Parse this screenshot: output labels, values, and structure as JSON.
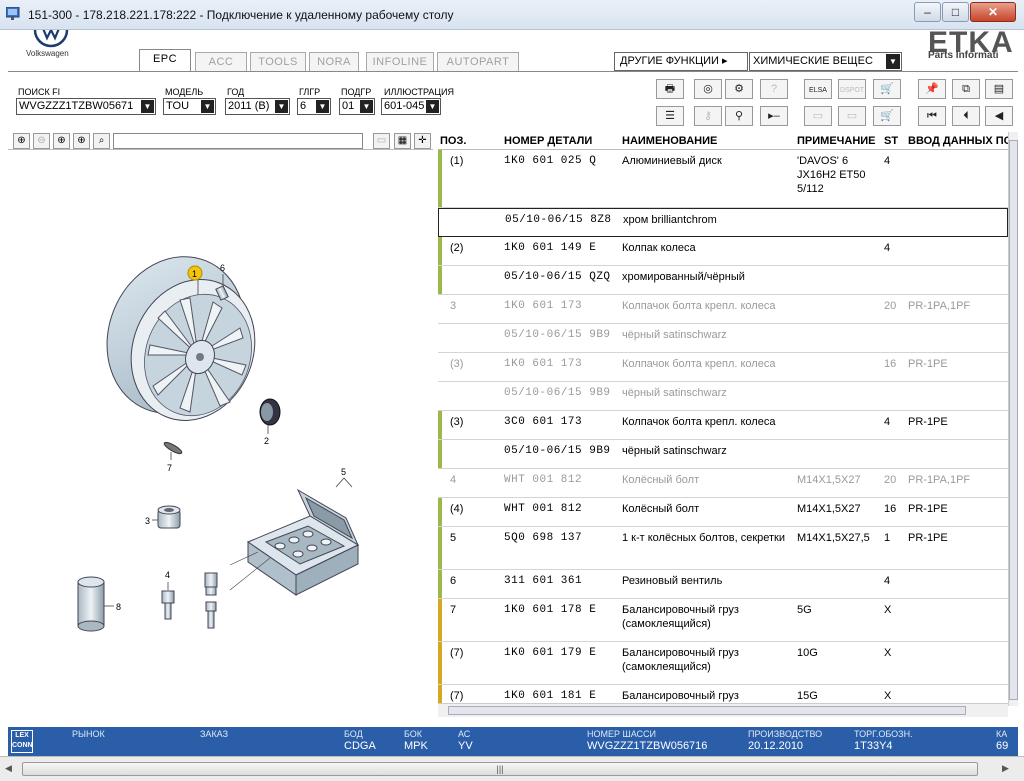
{
  "window": {
    "title": "151-300 - 178.218.221.178:222 - Подключение к удаленному рабочему столу",
    "min": "–",
    "max": "□",
    "close": "✕"
  },
  "brand": {
    "vw": "Volkswagen",
    "etka": "ETKA",
    "etka_sub": "Parts Informati"
  },
  "tabs": [
    "EPC",
    "ACC",
    "TOOLS",
    "NORA",
    "INFOLINE",
    "AUTOPART"
  ],
  "other_functions": "ДРУГИЕ ФУНКЦИИ ▸",
  "chem_select": "ХИМИЧЕСКИЕ ВЕЩЕС",
  "filters": {
    "search_label": "ПОИСК FI",
    "search_value": "WVGZZZ1TZBW05671",
    "model_label": "МОДЕЛЬ",
    "model_value": "TOU",
    "year_label": "ГОД",
    "year_value": "2011 (B)",
    "glgr_label": "ГЛГР",
    "glgr_value": "6",
    "podgr_label": "ПОДГР",
    "podgr_value": "01",
    "ill_label": "ИЛЛЮСТРАЦИЯ",
    "ill_value": "601-045"
  },
  "columns": {
    "pos": "ПОЗ.",
    "pn": "НОМЕР ДЕТАЛИ",
    "name": "НАИМЕНОВАНИЕ",
    "note": "ПРИМЕЧАНИЕ",
    "st": "ST",
    "inp": "ВВОД ДАННЫХ ПО"
  },
  "rows": [
    {
      "pos": "(1)",
      "pn": "1K0 601 025 Q",
      "name": "Алюминиевый диск",
      "note": "'DAVOS' 6 JX16H2 ET50 5/112",
      "st": "4",
      "inp": ""
    },
    {
      "pos": "",
      "pn": "05/10-06/15 8Z8",
      "name": "хром brilliantchrom",
      "note": "",
      "st": "",
      "inp": ""
    },
    {
      "pos": "(2)",
      "pn": "1K0 601 149 E",
      "name": "Колпак колеса",
      "note": "",
      "st": "4",
      "inp": ""
    },
    {
      "pos": "",
      "pn": "05/10-06/15 QZQ",
      "name": "хромированный/чёрный",
      "note": "",
      "st": "",
      "inp": ""
    },
    {
      "pos": "3",
      "pn": "1K0 601 173",
      "name": "Колпачок болта крепл. колеса",
      "note": "",
      "st": "20",
      "inp": "PR-1PA,1PF"
    },
    {
      "pos": "",
      "pn": "05/10-06/15 9B9",
      "name": "чёрный satinschwarz",
      "note": "",
      "st": "",
      "inp": ""
    },
    {
      "pos": "(3)",
      "pn": "1K0 601 173",
      "name": "Колпачок болта крепл. колеса",
      "note": "",
      "st": "16",
      "inp": "PR-1PE"
    },
    {
      "pos": "",
      "pn": "05/10-06/15 9B9",
      "name": "чёрный satinschwarz",
      "note": "",
      "st": "",
      "inp": ""
    },
    {
      "pos": "(3)",
      "pn": "3C0 601 173",
      "name": "Колпачок болта крепл. колеса",
      "note": "",
      "st": "4",
      "inp": "PR-1PE"
    },
    {
      "pos": "",
      "pn": "05/10-06/15 9B9",
      "name": "чёрный satinschwarz",
      "note": "",
      "st": "",
      "inp": ""
    },
    {
      "pos": "4",
      "pn": "WHT 001 812",
      "name": "Колёсный болт",
      "note": "M14X1,5X27",
      "st": "20",
      "inp": "PR-1PA,1PF"
    },
    {
      "pos": "(4)",
      "pn": "WHT 001 812",
      "name": "Колёсный болт",
      "note": "M14X1,5X27",
      "st": "16",
      "inp": "PR-1PE"
    },
    {
      "pos": "5",
      "pn": "5Q0 698 137",
      "name": "1 к-т колёсных болтов, секретки",
      "note": "M14X1,5X27,5",
      "st": "1",
      "inp": "PR-1PE"
    },
    {
      "pos": "6",
      "pn": "311 601 361",
      "name": "Резиновый вентиль",
      "note": "",
      "st": "4",
      "inp": ""
    },
    {
      "pos": "7",
      "pn": "1K0 601 178 E",
      "name": "Балансировочный груз (самоклеящийся)",
      "note": "5G",
      "st": "X",
      "inp": ""
    },
    {
      "pos": "(7)",
      "pn": "1K0 601 179 E",
      "name": "Балансировочный груз (самоклеящийся)",
      "note": "10G",
      "st": "X",
      "inp": ""
    },
    {
      "pos": "(7)",
      "pn": "1K0 601 181 E",
      "name": "Балансировочный груз",
      "note": "15G",
      "st": "X",
      "inp": ""
    }
  ],
  "callouts": [
    "1",
    "6",
    "2",
    "7",
    "5",
    "3",
    "4",
    "8"
  ],
  "status": {
    "lex": "LEX CONN",
    "market_label": "РЫНОК",
    "order_label": "ЗАКАЗ",
    "bod_label": "БОД",
    "bod_value": "CDGA",
    "bok_label": "БОК",
    "bok_value": "MPK",
    "ac_label": "АС",
    "ac_value": "YV",
    "chassis_label": "НОМЕР ШАССИ",
    "chassis_value": "WVGZZZ1TZBW056716",
    "prod_label": "ПРОИЗВОДСТВО",
    "prod_value": "20.12.2010",
    "torg_label": "ТОРГ.ОБОЗН.",
    "torg_value": "1T33Y4",
    "ka_label": "КА",
    "ka_value": "69"
  },
  "colors": {
    "row_green": "#9bb84a",
    "row_yellow": "#d6a821",
    "status_blue": "#2a5ea8",
    "callout_yellow": "#f2c40c"
  }
}
